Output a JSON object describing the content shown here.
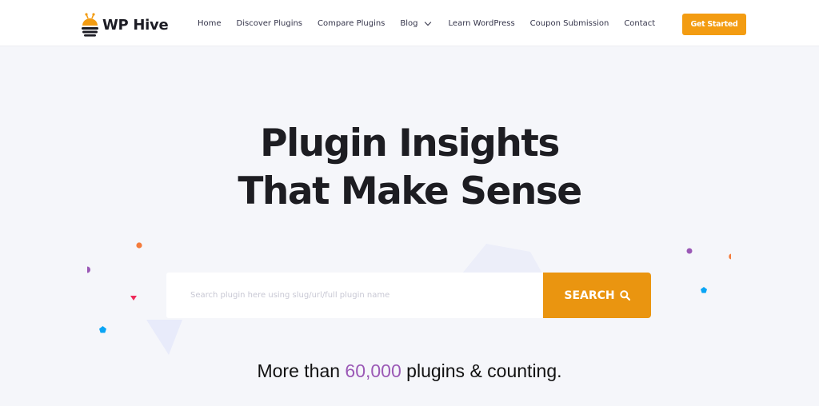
{
  "header": {
    "brand": "WP Hive",
    "nav": [
      {
        "label": "Home"
      },
      {
        "label": "Discover Plugins"
      },
      {
        "label": "Compare Plugins"
      },
      {
        "label": "Blog",
        "has_dropdown": true
      },
      {
        "label": "Learn WordPress"
      },
      {
        "label": "Coupon Submission"
      },
      {
        "label": "Contact"
      }
    ],
    "cta_label": "Get Started"
  },
  "hero": {
    "title_line1": "Plugin Insights",
    "title_line2": "That Make Sense",
    "search": {
      "value": "",
      "placeholder": "Search plugin here using slug/url/full plugin name",
      "button_label": "SEARCH",
      "button_icon": "search-icon"
    },
    "tagline": {
      "prefix": "More than ",
      "count": "60,000",
      "suffix": " plugins & counting."
    }
  },
  "colors": {
    "accent": "#f39c12",
    "highlight": "#9b59b6",
    "background": "#f5f6fa"
  }
}
